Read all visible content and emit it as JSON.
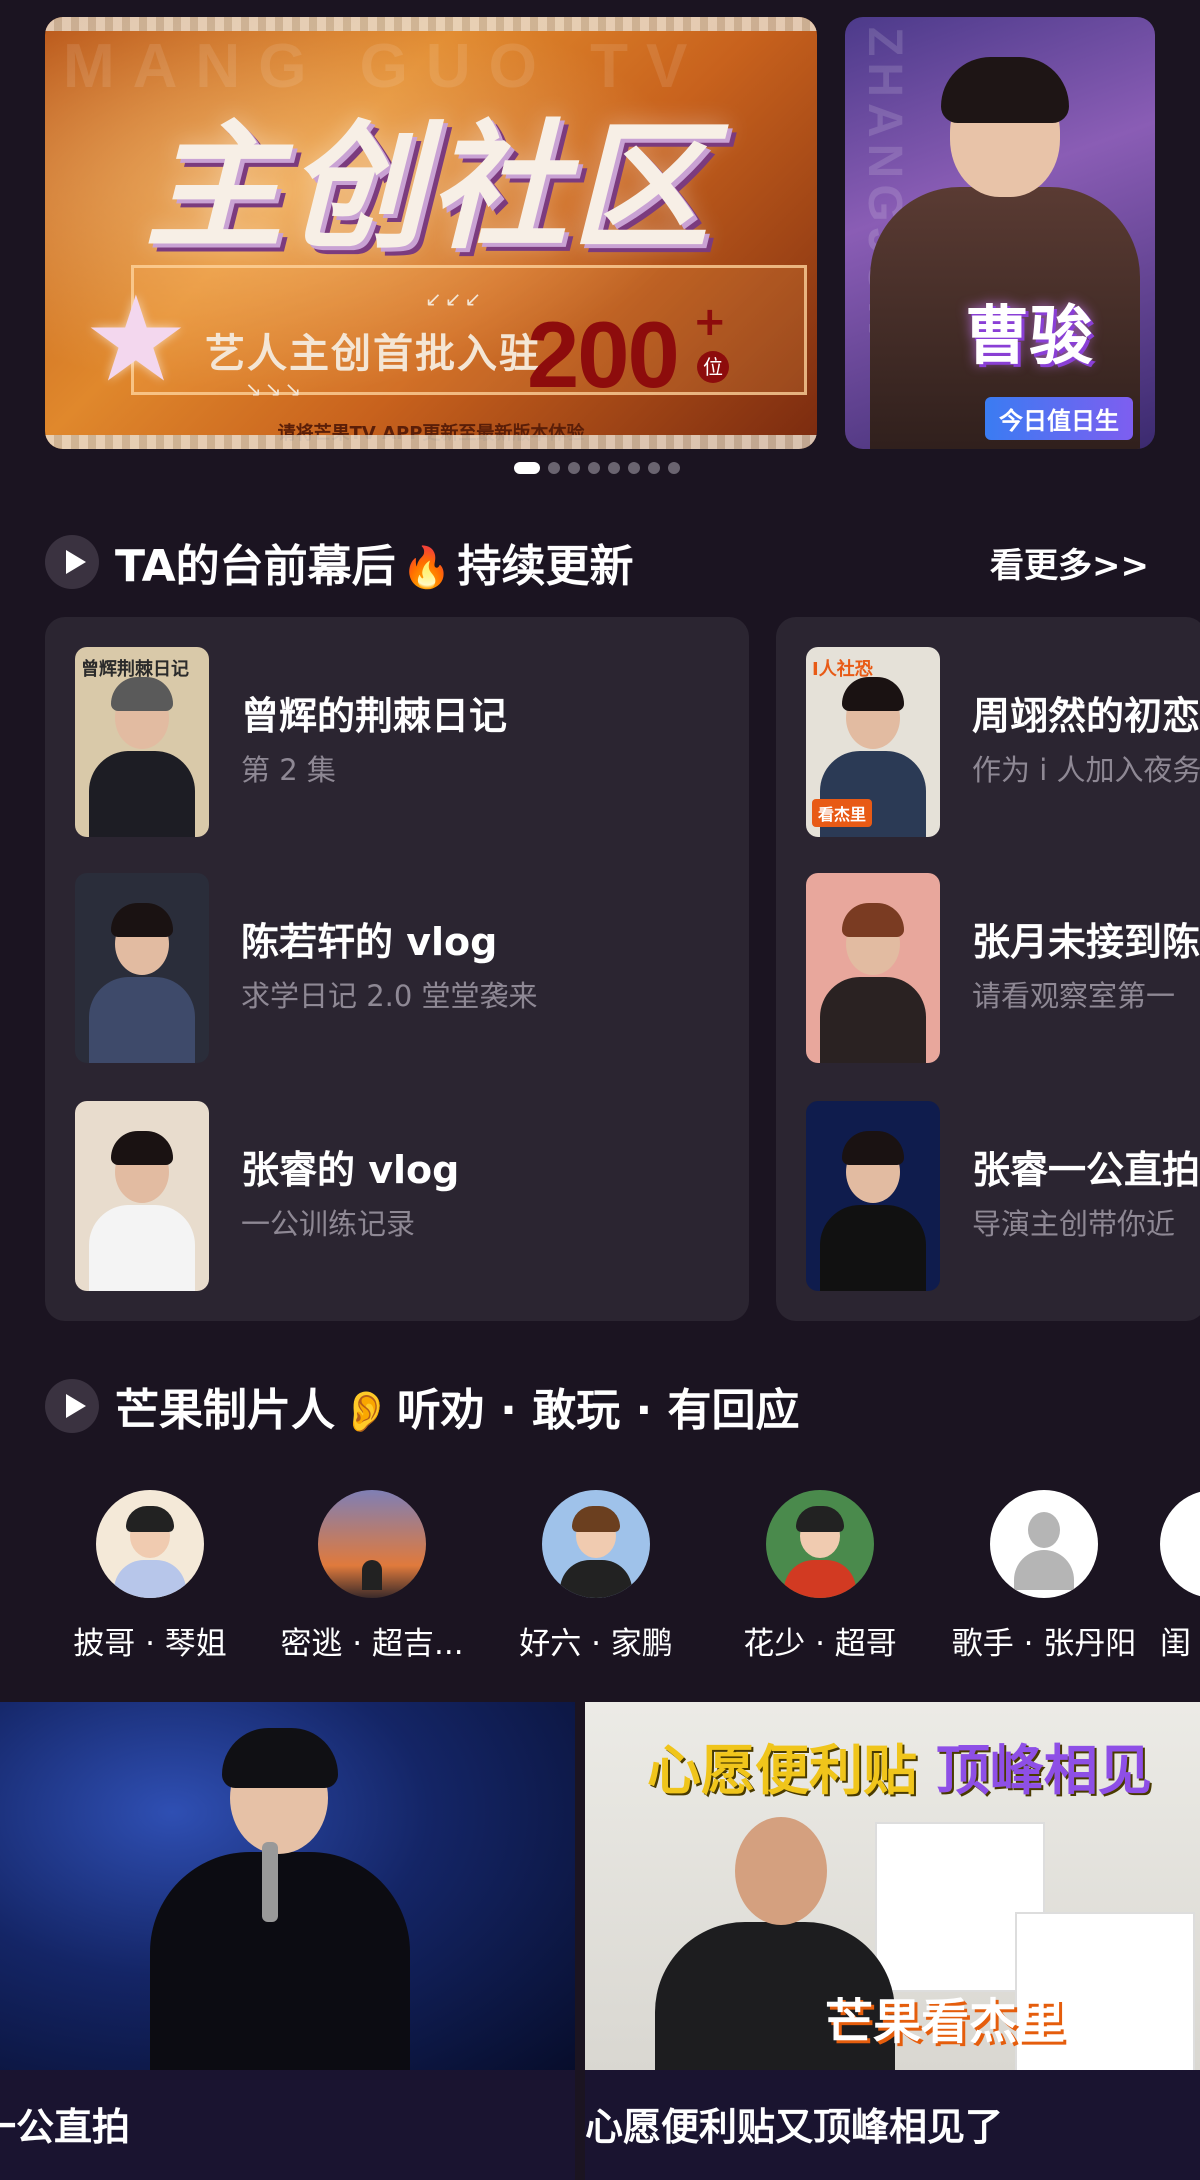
{
  "banner": {
    "main": {
      "bg_text": "MANG GUO TV",
      "title": "主创社区",
      "subtitle": "艺人主创首批入驻",
      "count": "200",
      "count_plus": "+",
      "count_unit": "位",
      "note": "请将芒果TV APP更新至最新版本体验"
    },
    "side": {
      "vertical_text": "ZHANGJUN",
      "name": "曹骏",
      "badge": "今日值日生"
    },
    "dots_total": 9,
    "active_dot": 1
  },
  "section1": {
    "title": "TA的台前幕后",
    "emoji": "🔥",
    "title_suffix": "持续更新",
    "see_more": "看更多>>"
  },
  "episodes": [
    {
      "title": "曾辉的荆棘日记",
      "subtitle": "第 2 集",
      "thumb_tag": "",
      "thumb_top": "曾辉荆棘日记",
      "thumb_color": "#d9c9a9"
    },
    {
      "title": "陈若轩的 vlog",
      "subtitle": "求学日记 2.0 堂堂袭来",
      "thumb_tag": "",
      "thumb_top": "",
      "thumb_color": "#2a2d3a"
    },
    {
      "title": "张睿的 vlog",
      "subtitle": "一公训练记录",
      "thumb_tag": "",
      "thumb_top": "",
      "thumb_color": "#e8dccd"
    },
    {
      "title": "周翊然的初恋",
      "subtitle": "作为 i 人加入夜务",
      "thumb_tag": "看杰里",
      "thumb_top": "I人社恐",
      "thumb_color": "#e5e1d8"
    },
    {
      "title": "张月未接到陈",
      "subtitle": "请看观察室第一",
      "thumb_tag": "",
      "thumb_top": "",
      "thumb_color": "#e8a79c"
    },
    {
      "title": "张睿一公直拍",
      "subtitle": "导演主创带你近",
      "thumb_tag": "",
      "thumb_top": "",
      "thumb_color": "#0f1c4d"
    }
  ],
  "section2": {
    "title": "芒果制片人",
    "emoji": "👂",
    "title_suffix": "听劝 · 敢玩 · 有回应"
  },
  "producers": [
    {
      "name": "披哥 · 琴姐",
      "color": "#f4e9d8"
    },
    {
      "name": "密逃 · 超吉...",
      "color": "#e07a3c"
    },
    {
      "name": "好六 · 家鹏",
      "color": "#9fc2ea"
    },
    {
      "name": "花少 · 超哥",
      "color": "#4a8a4c"
    },
    {
      "name": "歌手 · 张丹阳",
      "color": "#ffffff"
    },
    {
      "name": "闺",
      "color": "#ffffff"
    }
  ],
  "videos": [
    {
      "caption": "一公直拍"
    },
    {
      "caption": "心愿便利贴又顶峰相见了",
      "headline": "心愿便利贴",
      "headline_accent": "顶峰相见",
      "logo": "芒果看杰里"
    }
  ]
}
